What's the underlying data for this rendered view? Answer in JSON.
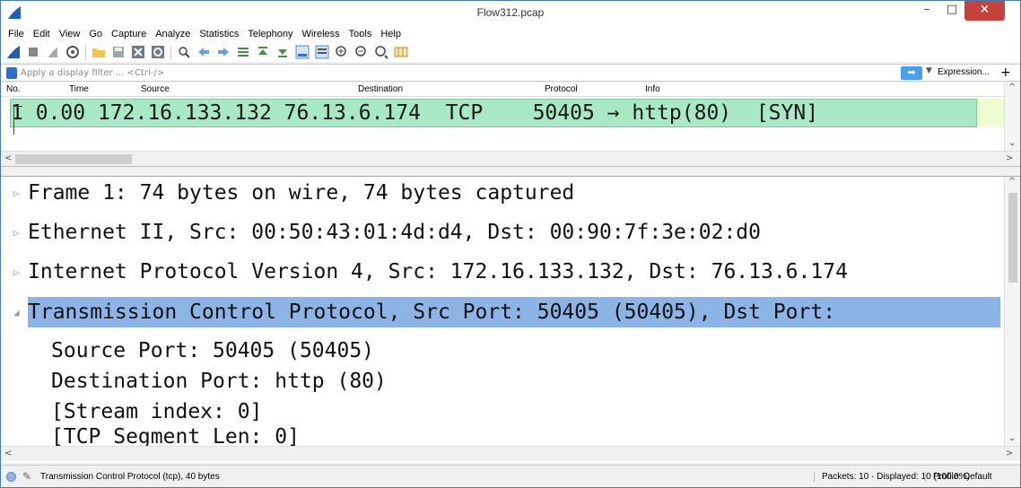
{
  "window": {
    "title": "Flow312.pcap",
    "minimize": "–",
    "maximize": "□",
    "close": "×"
  },
  "menu": [
    "File",
    "Edit",
    "View",
    "Go",
    "Capture",
    "Analyze",
    "Statistics",
    "Telephony",
    "Wireless",
    "Tools",
    "Help"
  ],
  "filter": {
    "placeholder": "Apply a display filter ... <Ctrl-/>",
    "expression": "Expression...",
    "plus": "+"
  },
  "packet_list": {
    "columns": [
      "No.",
      "Time",
      "Source",
      "Destination",
      "Protocol",
      "Info"
    ],
    "row": "1 0.00 172.16.133.132 76.13.6.174  TCP    50405 → http(80)  [SYN]"
  },
  "details": {
    "lines": [
      "Frame 1: 74 bytes on wire, 74 bytes captured",
      "Ethernet II, Src: 00:50:43:01:4d:d4, Dst: 00:90:7f:3e:02:d0",
      "Internet Protocol Version 4, Src: 172.16.133.132, Dst: 76.13.6.174",
      "Transmission Control Protocol, Src Port: 50405 (50405), Dst Port:",
      "Source Port: 50405 (50405)",
      "Destination Port: http (80)",
      "[Stream index: 0]",
      "[TCP Segment Len: 0]"
    ]
  },
  "status": {
    "field": "Transmission Control Protocol (tcp), 40 bytes",
    "packets": "Packets: 10 · Displayed: 10 (100.0%)",
    "profile": "Profile: Default"
  },
  "colors": {
    "selected_row": "#a8e8c4",
    "selected_tree": "#8cb4e6"
  }
}
